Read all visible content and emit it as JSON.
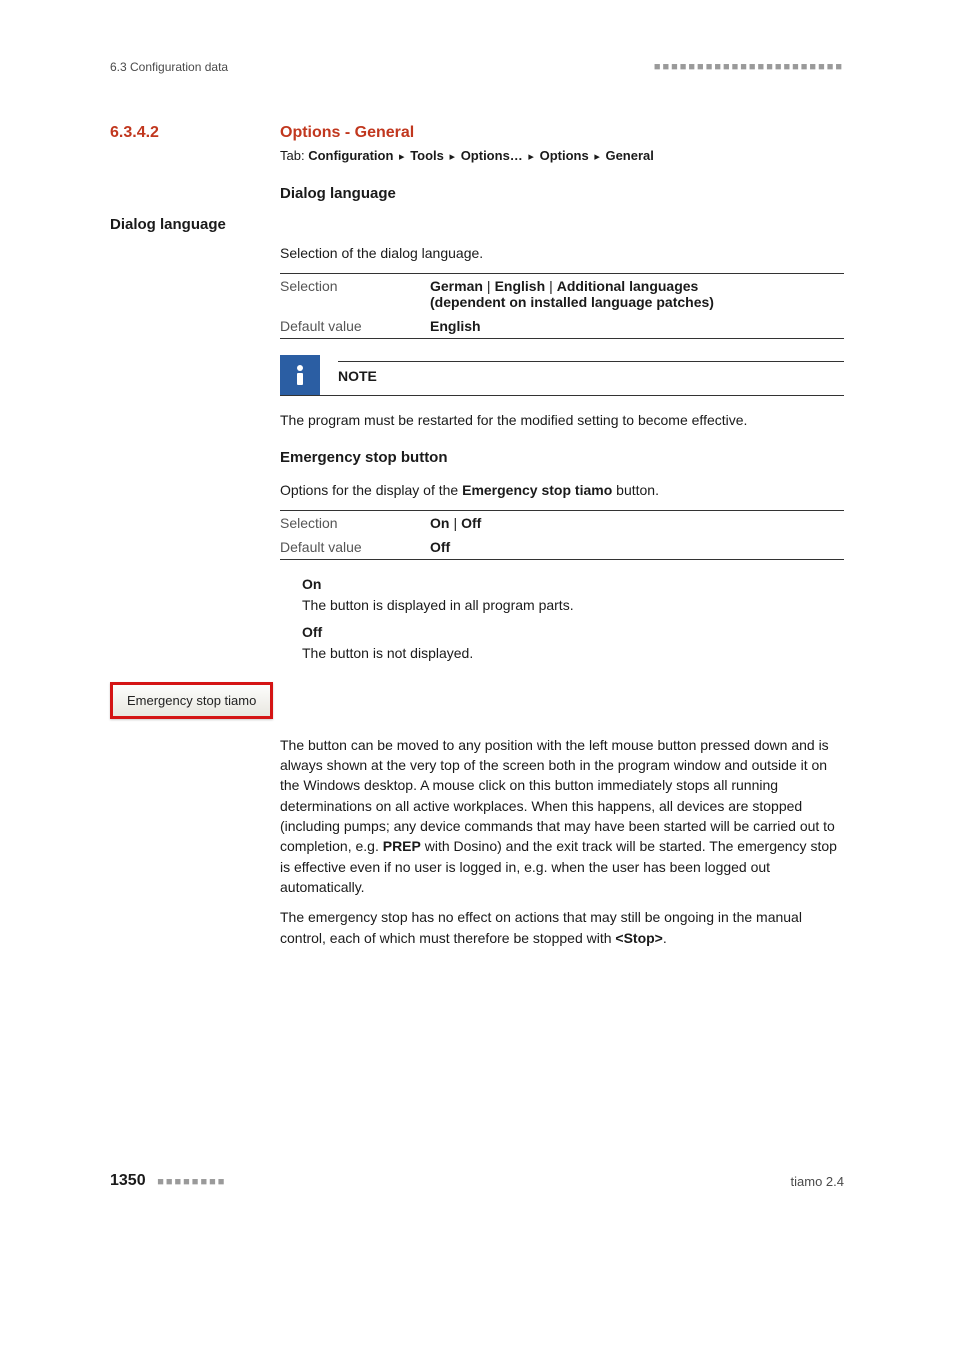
{
  "runhead": {
    "left": "6.3 Configuration data"
  },
  "section": {
    "number": "6.3.4.2",
    "title": "Options - General"
  },
  "tabline": {
    "prefix": "Tab:",
    "parts": [
      "Configuration",
      "Tools",
      "Options…",
      "Options",
      "General"
    ]
  },
  "dialog_lang": {
    "heading": "Dialog language",
    "side_label": "Dialog language",
    "desc": "Selection of the dialog language.",
    "selection_label": "Selection",
    "selection_vals": [
      "German",
      "English",
      "Additional languages"
    ],
    "selection_paren": "(dependent on installed language patches)",
    "default_label": "Default value",
    "default_val": "English"
  },
  "note": {
    "label": "NOTE",
    "body": "The program must be restarted for the modified setting to become effective."
  },
  "emergency": {
    "heading": "Emergency stop button",
    "intro_pre": "Options for the display of the ",
    "intro_bold": "Emergency stop tiamo",
    "intro_post": " button.",
    "selection_label": "Selection",
    "selection_vals": [
      "On",
      "Off"
    ],
    "default_label": "Default value",
    "default_val": "Off",
    "opt_on_name": "On",
    "opt_on_desc": "The button is displayed in all program parts.",
    "opt_off_name": "Off",
    "opt_off_desc": "The button is not displayed.",
    "button_label": "Emergency stop tiamo",
    "body1_pre": "The button can be moved to any position with the left mouse button pressed down and is always shown at the very top of the screen both in the program window and outside it on the Windows desktop. A mouse click on this button immediately stops all running determinations on all active workplaces. When this happens, all devices are stopped (including pumps; any device commands that may have been started will be carried out to completion, e.g. ",
    "body1_bold": "PREP",
    "body1_post": " with Dosino) and the exit track will be started. The emergency stop is effective even if no user is logged in, e.g. when the user has been logged out automatically.",
    "body2_pre": "The emergency stop has no effect on actions that may still be ongoing in the manual control, each of which must therefore be stopped with ",
    "body2_bold": "<Stop>",
    "body2_post": "."
  },
  "footer": {
    "page": "1350",
    "product": "tiamo 2.4"
  }
}
